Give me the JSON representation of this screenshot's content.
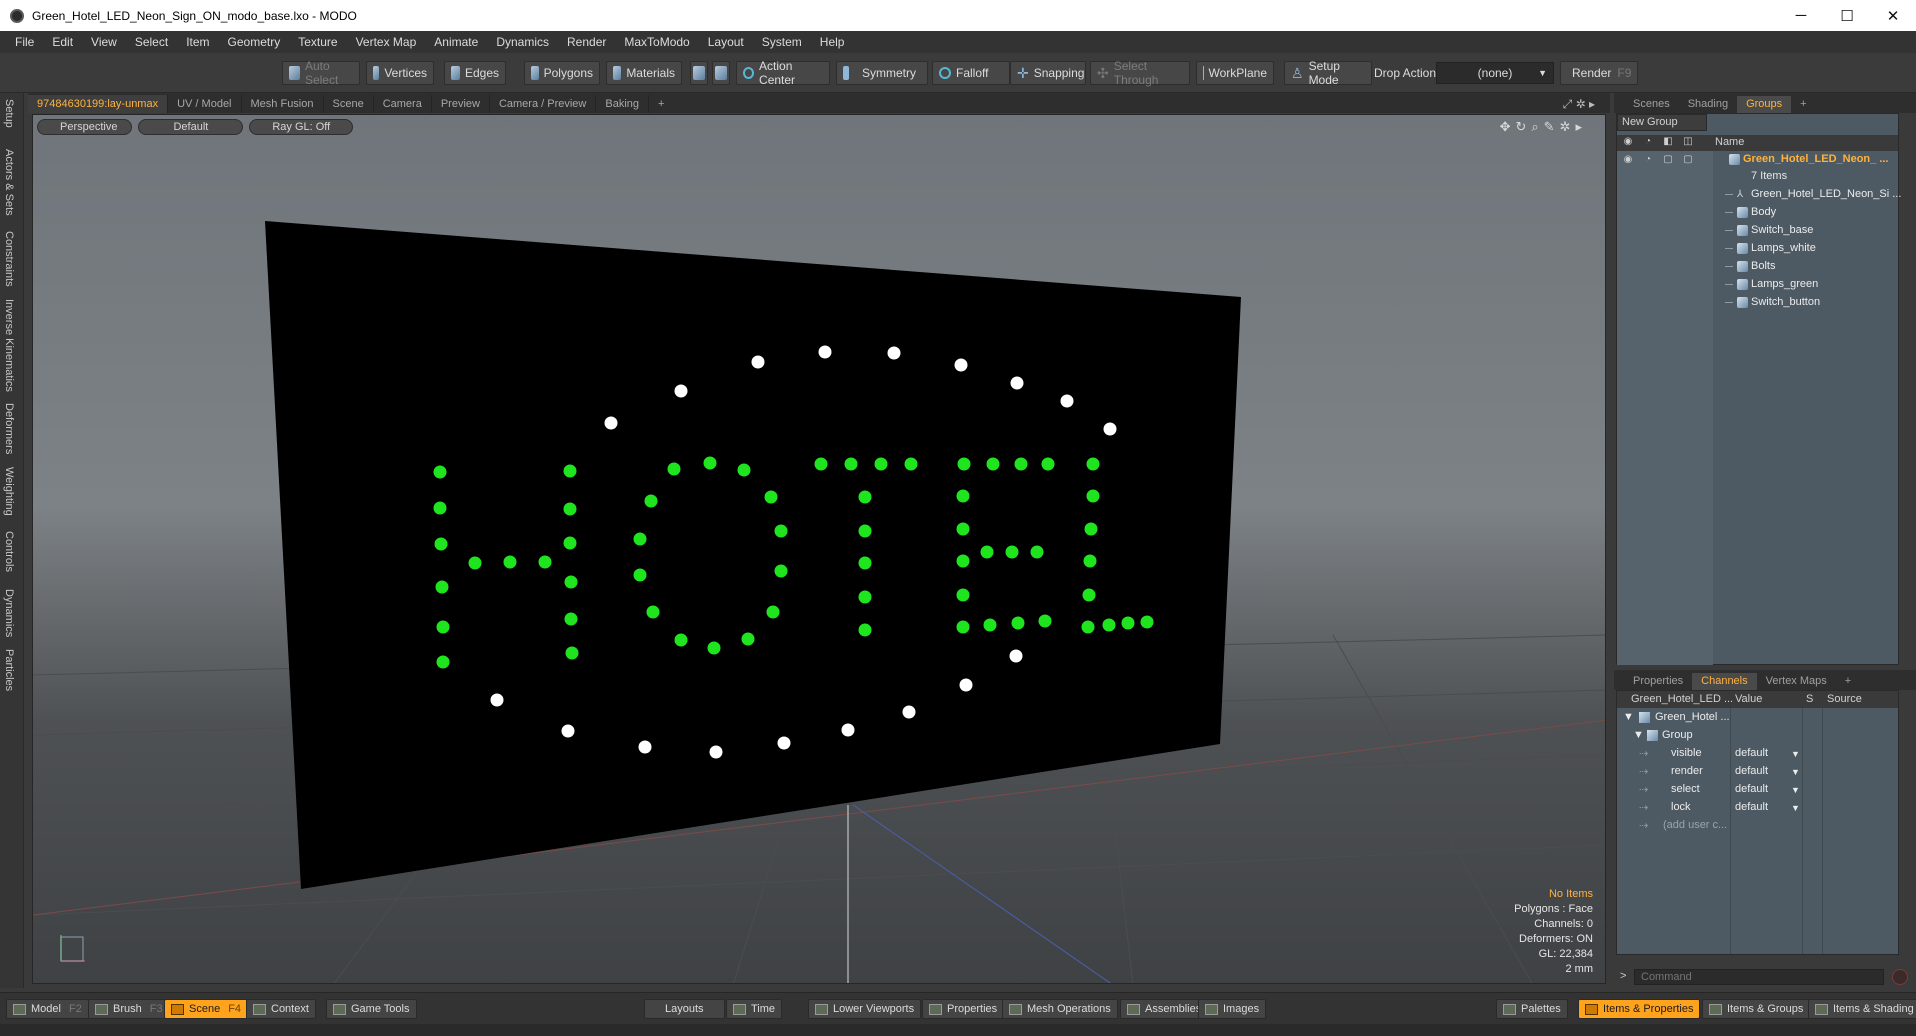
{
  "window": {
    "title": "Green_Hotel_LED_Neon_Sign_ON_modo_base.lxo - MODO",
    "minimize": "─",
    "maximize": "☐",
    "close": "✕"
  },
  "menu": [
    "File",
    "Edit",
    "View",
    "Select",
    "Item",
    "Geometry",
    "Texture",
    "Vertex Map",
    "Animate",
    "Dynamics",
    "Render",
    "MaxToModo",
    "Layout",
    "System",
    "Help"
  ],
  "toolbar": {
    "auto_select": "Auto Select",
    "vertices": "Vertices",
    "edges": "Edges",
    "polygons": "Polygons",
    "materials": "Materials",
    "action_center": "Action Center",
    "symmetry": "Symmetry",
    "falloff": "Falloff",
    "snapping": "Snapping",
    "select_through": "Select Through",
    "workplane": "WorkPlane",
    "setup_mode": "Setup Mode",
    "drop_action_label": "Drop Action",
    "drop_action_value": "(none)",
    "render": "Render",
    "render_key": "F9"
  },
  "left_tabs": [
    "Setup",
    "Actors & Sets",
    "Constraints",
    "Inverse Kinematics",
    "Deformers",
    "Weighting",
    "Controls",
    "Dynamics",
    "Particles"
  ],
  "viewport_tabs": [
    "97484630199:lay-unmax",
    "UV / Model",
    "Mesh Fusion",
    "Scene",
    "Camera",
    "Preview",
    "Camera / Preview",
    "Baking",
    "+"
  ],
  "viewport": {
    "perspective": "Perspective",
    "shading": "Default",
    "raygl": "Ray GL: Off",
    "info": {
      "items": "No Items",
      "polygons": "Polygons : Face",
      "channels": "Channels: 0",
      "deformers": "Deformers: ON",
      "gl": "GL: 22,384",
      "scale": "2 mm"
    }
  },
  "right_tabs_top": [
    "Scenes",
    "Shading",
    "Groups",
    "+"
  ],
  "groups": {
    "new_group": "New Group",
    "name_header": "Name",
    "top_item": "Green_Hotel_LED_Neon_ ...",
    "count": "7 Items",
    "children": [
      "Green_Hotel_LED_Neon_Si ...",
      "Body",
      "Switch_base",
      "Lamps_white",
      "Bolts",
      "Lamps_green",
      "Switch_button"
    ]
  },
  "right_tabs_bottom": [
    "Properties",
    "Channels",
    "Vertex Maps",
    "+"
  ],
  "channels": {
    "headers": {
      "name": "Green_Hotel_LED ...",
      "value": "Value",
      "s": "S",
      "source": "Source"
    },
    "item": "Green_Hotel ...",
    "group": "Group",
    "rows": [
      {
        "name": "visible",
        "value": "default"
      },
      {
        "name": "render",
        "value": "default"
      },
      {
        "name": "select",
        "value": "default"
      },
      {
        "name": "lock",
        "value": "default"
      }
    ],
    "add_user": "(add user c..."
  },
  "command": {
    "placeholder": "Command",
    "prompt": ">"
  },
  "bottom": {
    "model": "Model",
    "model_key": "F2",
    "brush": "Brush",
    "brush_key": "F3",
    "scene": "Scene",
    "scene_key": "F4",
    "context": "Context",
    "game_tools": "Game Tools",
    "layouts": "Layouts",
    "time": "Time",
    "lower_viewports": "Lower Viewports",
    "properties": "Properties",
    "mesh_operations": "Mesh Operations",
    "assemblies": "Assemblies",
    "images": "Images",
    "palettes": "Palettes",
    "items_properties": "Items & Properties",
    "items_groups": "Items & Groups",
    "items_shading": "Items & Shading"
  },
  "colors": {
    "accent": "#ffa21c",
    "led_green": "#1fe51f",
    "led_white": "#ffffff",
    "sign_panel": "#000000"
  },
  "icons": {
    "selection_modes": "cube-icon",
    "falloff": "ring-icon",
    "setup": "figure-icon",
    "render": "render-icon",
    "eye": "eye-icon",
    "lock": "lock-icon",
    "command_record": "record-icon"
  }
}
